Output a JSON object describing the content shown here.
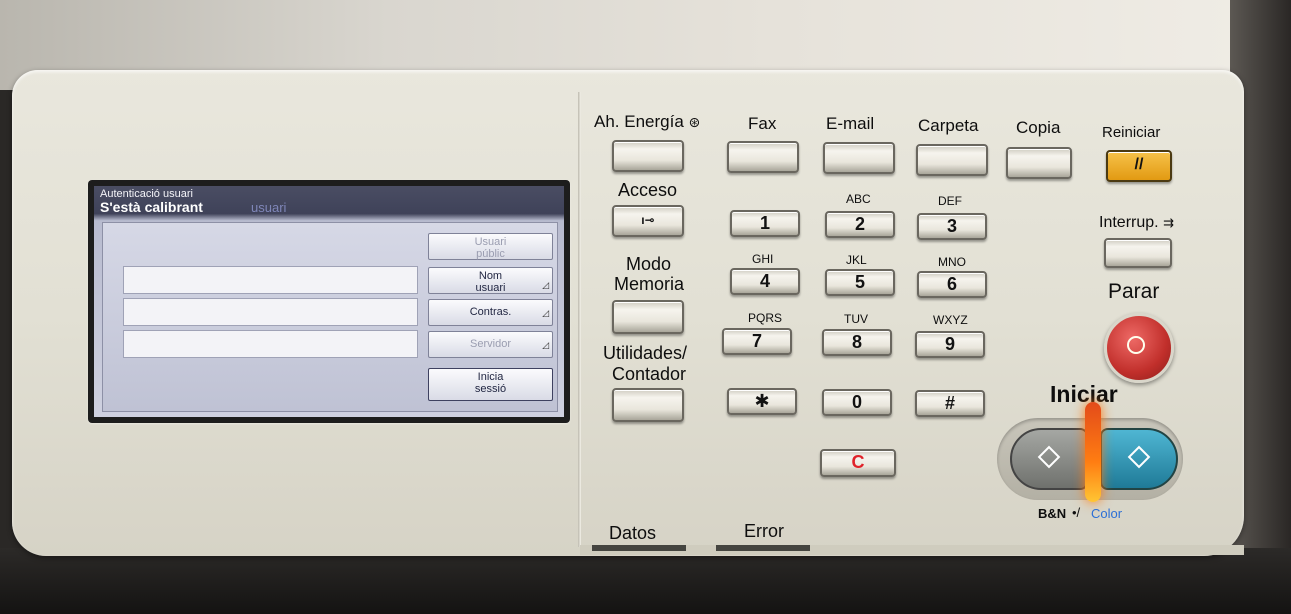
{
  "screen": {
    "title": "Autenticació usuari",
    "status": "S'està calibrant",
    "status_suffix": "usuari",
    "buttons": {
      "public_user_line1": "Usuari",
      "public_user_line2": "públic",
      "user_name_line1": "Nom",
      "user_name_line2": "usuari",
      "password": "Contras.",
      "server": "Servidor",
      "login_line1": "Inicia",
      "login_line2": "sessió"
    }
  },
  "mode_keys": {
    "energy": "Ah. Energía",
    "fax": "Fax",
    "email": "E-mail",
    "folder": "Carpeta",
    "copy": "Copia",
    "reset": "Reiniciar"
  },
  "side_labels": {
    "access": "Acceso",
    "memory_mode_line1": "Modo",
    "memory_mode_line2": "Memoria",
    "utilities_line1": "Utilidades/",
    "utilities_line2": "Contador",
    "interrupt": "Interrup.",
    "stop": "Parar",
    "start": "Iniciar",
    "bw": "B&N",
    "color": "Color",
    "data": "Datos",
    "error": "Error"
  },
  "keypad": {
    "keys": [
      {
        "digit": "1",
        "letters": ""
      },
      {
        "digit": "2",
        "letters": "ABC"
      },
      {
        "digit": "3",
        "letters": "DEF"
      },
      {
        "digit": "4",
        "letters": "GHI"
      },
      {
        "digit": "5",
        "letters": "JKL"
      },
      {
        "digit": "6",
        "letters": "MNO"
      },
      {
        "digit": "7",
        "letters": "PQRS"
      },
      {
        "digit": "8",
        "letters": "TUV"
      },
      {
        "digit": "9",
        "letters": "WXYZ"
      },
      {
        "digit": "✱",
        "letters": ""
      },
      {
        "digit": "0",
        "letters": ""
      },
      {
        "digit": "#",
        "letters": ""
      }
    ],
    "clear": "C",
    "access_key_glyph": "ı⊸"
  },
  "icons": {
    "energy": "power-save-icon",
    "reset": "reset-slash-icon",
    "stop": "stop-icon",
    "start": "start-diamond-icon",
    "access": "key-icon"
  },
  "colors": {
    "reset_button": "#f0b32e",
    "stop_button": "#d2403c",
    "start_color_button": "#2b93b3",
    "start_led": "#ff7a10"
  }
}
